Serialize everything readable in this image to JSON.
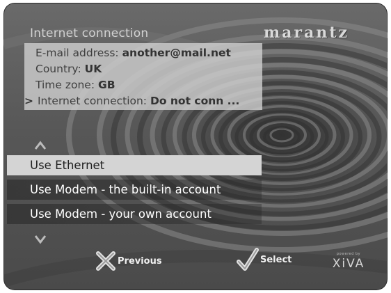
{
  "header": {
    "title": "Internet connection",
    "brand": "marantz"
  },
  "info": {
    "rows": [
      {
        "label": "E-mail address:",
        "value": "another@mail.net"
      },
      {
        "label": "Country:",
        "value": "UK"
      },
      {
        "label": "Time zone:",
        "value": "GB"
      },
      {
        "label": "Internet connection:",
        "value": "Do not conn ...",
        "cursor": ">"
      }
    ]
  },
  "menu": {
    "selected_index": 0,
    "items": [
      {
        "label": "Use Ethernet"
      },
      {
        "label": "Use Modem - the built-in account"
      },
      {
        "label": "Use Modem - your own account"
      }
    ]
  },
  "footer": {
    "previous_label": "Previous",
    "select_label": "Select",
    "powered_by": "powered by",
    "xiva_name": "XiVA"
  },
  "colors": {
    "highlight": "#d4d4d4",
    "panel": "#cdcdcd",
    "background": "#575757",
    "text_light": "#ffffff"
  },
  "icons": {
    "previous": "x-cross-icon",
    "select": "checkmark-icon",
    "scroll_up": "chevron-up-icon",
    "scroll_down": "chevron-down-icon"
  }
}
